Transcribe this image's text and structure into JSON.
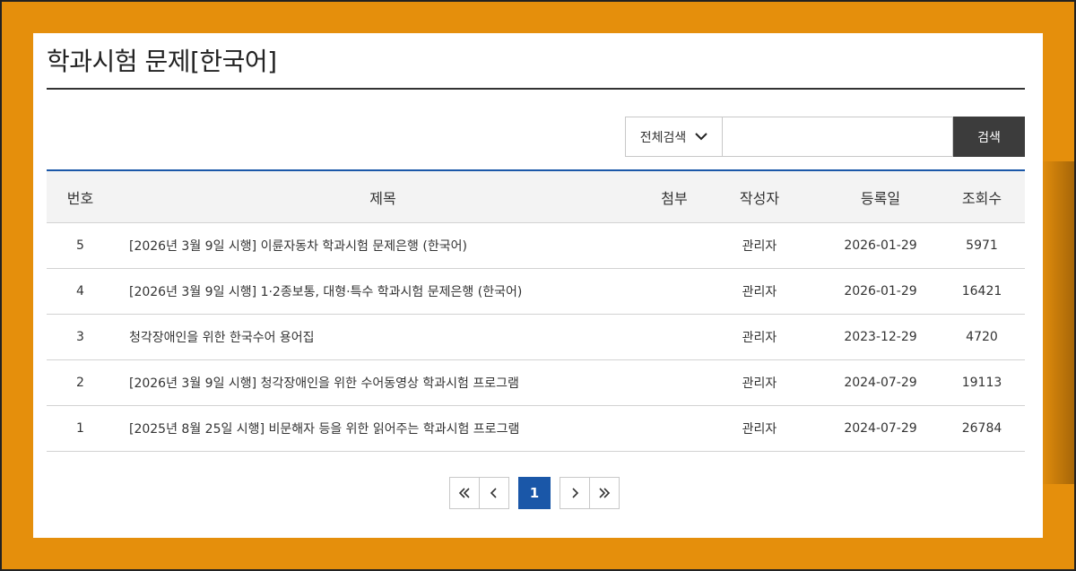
{
  "page": {
    "title": "학과시험 문제[한국어]"
  },
  "search": {
    "select_label": "전체검색",
    "input_value": "",
    "button_label": "검색"
  },
  "table": {
    "headers": {
      "num": "번호",
      "subject": "제목",
      "attach": "첨부",
      "author": "작성자",
      "date": "등록일",
      "views": "조회수"
    },
    "rows": [
      {
        "num": "5",
        "subject": "[2026년 3월 9일 시행] 이륜자동차 학과시험 문제은행 (한국어)",
        "attach": "",
        "author": "관리자",
        "date": "2026-01-29",
        "views": "5971"
      },
      {
        "num": "4",
        "subject": "[2026년 3월 9일 시행] 1·2종보통, 대형·특수 학과시험 문제은행 (한국어)",
        "attach": "",
        "author": "관리자",
        "date": "2026-01-29",
        "views": "16421"
      },
      {
        "num": "3",
        "subject": "청각장애인을 위한 한국수어 용어집",
        "attach": "",
        "author": "관리자",
        "date": "2023-12-29",
        "views": "4720"
      },
      {
        "num": "2",
        "subject": "[2026년 3월 9일 시행] 청각장애인을 위한 수어동영상 학과시험 프로그램",
        "attach": "",
        "author": "관리자",
        "date": "2024-07-29",
        "views": "19113"
      },
      {
        "num": "1",
        "subject": "[2025년 8월 25일 시행] 비문해자 등을 위한 읽어주는 학과시험 프로그램",
        "attach": "",
        "author": "관리자",
        "date": "2024-07-29",
        "views": "26784"
      }
    ]
  },
  "pagination": {
    "current_page": "1"
  },
  "colors": {
    "accent": "#1a57a8",
    "background": "#e58f0c",
    "search_button": "#3c3c3c"
  },
  "icons": {
    "select": "chevron-down-icon",
    "first": "double-chevron-left-icon",
    "prev": "chevron-left-icon",
    "next": "chevron-right-icon",
    "last": "double-chevron-right-icon"
  }
}
